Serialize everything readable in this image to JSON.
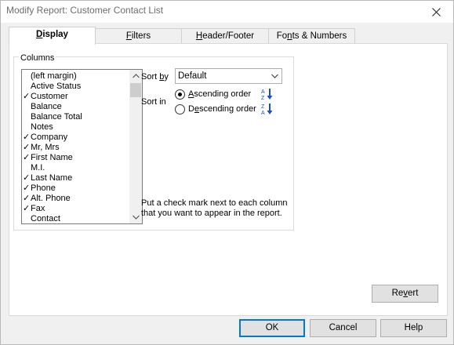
{
  "window": {
    "title": "Modify Report: Customer Contact List",
    "close_icon": "close-icon"
  },
  "tabs": [
    {
      "pre": "",
      "ul": "D",
      "post": "isplay",
      "active": true
    },
    {
      "pre": "",
      "ul": "F",
      "post": "ilters",
      "active": false
    },
    {
      "pre": "",
      "ul": "H",
      "post": "eader/Footer",
      "active": false
    },
    {
      "pre": "Fo",
      "ul": "n",
      "post": "ts & Numbers",
      "active": false
    }
  ],
  "columns": {
    "group_label": "Columns",
    "items": [
      {
        "label": "(left margin)",
        "checked": false
      },
      {
        "label": "Active Status",
        "checked": false
      },
      {
        "label": "Customer",
        "checked": true
      },
      {
        "label": "Balance",
        "checked": false
      },
      {
        "label": "Balance Total",
        "checked": false
      },
      {
        "label": "Notes",
        "checked": false
      },
      {
        "label": "Company",
        "checked": true
      },
      {
        "label": "Mr, Mrs",
        "checked": true
      },
      {
        "label": "First Name",
        "checked": true
      },
      {
        "label": "M.I.",
        "checked": false
      },
      {
        "label": "Last Name",
        "checked": true
      },
      {
        "label": "Phone",
        "checked": true
      },
      {
        "label": "Alt. Phone",
        "checked": true
      },
      {
        "label": "Fax",
        "checked": true
      },
      {
        "label": "Contact",
        "checked": false
      }
    ],
    "check_glyph": "✓"
  },
  "sort": {
    "sortby_pre": "Sort ",
    "sortby_ul": "b",
    "sortby_post": "y",
    "sortby_value": "Default",
    "sortin_label": "Sort in",
    "ascending_pre": "",
    "ascending_ul": "A",
    "ascending_post": "scending order",
    "descending_pre": "D",
    "descending_ul": "e",
    "descending_post": "scending order",
    "selected": "ascending"
  },
  "hint": "Put a check mark next to each column that you want to appear in the report.",
  "buttons": {
    "revert_pre": "Re",
    "revert_ul": "v",
    "revert_post": "ert",
    "ok": "OK",
    "cancel": "Cancel",
    "help": "Help"
  },
  "colors": {
    "accent": "#0078d7",
    "sort_icon_blue": "#1f4fbf"
  }
}
